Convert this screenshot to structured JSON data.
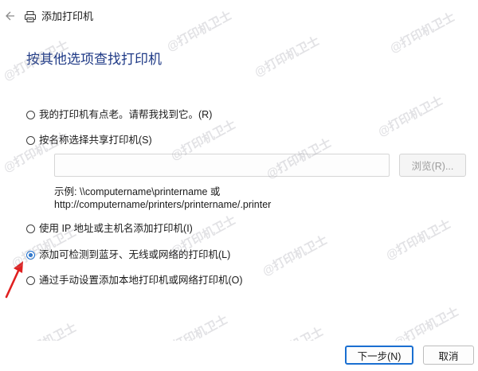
{
  "window": {
    "title": "添加打印机"
  },
  "heading": "按其他选项查找打印机",
  "options": [
    {
      "label": "我的打印机有点老。请帮我找到它。(R)",
      "checked": false
    },
    {
      "label": "按名称选择共享打印机(S)",
      "checked": false
    },
    {
      "label": "使用 IP 地址或主机名添加打印机(I)",
      "checked": false
    },
    {
      "label": "添加可检测到蓝牙、无线或网络的打印机(L)",
      "checked": true
    },
    {
      "label": "通过手动设置添加本地打印机或网络打印机(O)",
      "checked": false
    }
  ],
  "shared_printer": {
    "input_value": "",
    "browse_label": "浏览(R)...",
    "example_line1": "示例: \\\\computername\\printername 或",
    "example_line2": "http://computername/printers/printername/.printer"
  },
  "footer": {
    "next_label": "下一步(N)",
    "cancel_label": "取消"
  },
  "watermark": "@打印机卫士",
  "colors": {
    "heading": "#1f3a86",
    "accent": "#1a6fd1",
    "annotation_arrow": "#e02020"
  },
  "icons": {
    "back": "back-arrow-icon",
    "printer": "printer-icon"
  }
}
